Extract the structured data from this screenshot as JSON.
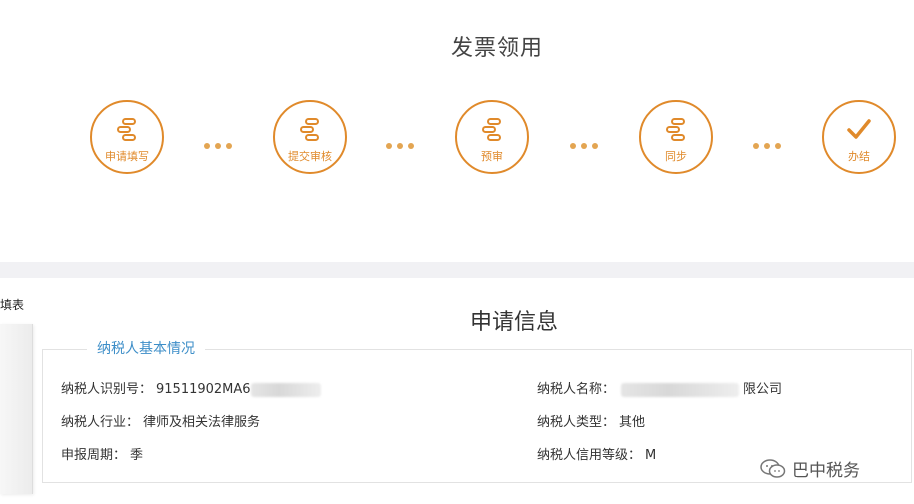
{
  "header": {
    "title": "发票领用"
  },
  "steps": [
    {
      "label": "申请填写",
      "icon": "flow-icon"
    },
    {
      "label": "提交审核",
      "icon": "flow-icon"
    },
    {
      "label": "预审",
      "icon": "flow-icon"
    },
    {
      "label": "同步",
      "icon": "flow-icon"
    },
    {
      "label": "办结",
      "icon": "check-icon"
    }
  ],
  "side": {
    "tab_label": "填表"
  },
  "section": {
    "title": "申请信息",
    "legend": "纳税人基本情况",
    "fields": {
      "tax_id": {
        "label": "纳税人识别号：",
        "value": "91511902MA6"
      },
      "industry": {
        "label": "纳税人行业：",
        "value": "律师及相关法律服务"
      },
      "period": {
        "label": "申报周期：",
        "value": "季"
      },
      "name": {
        "label": "纳税人名称：",
        "value": "限公司"
      },
      "type": {
        "label": "纳税人类型：",
        "value": "其他"
      },
      "credit": {
        "label": "纳税人信用等级：",
        "value": "M"
      }
    }
  },
  "watermark": {
    "text": "巴中税务"
  },
  "colors": {
    "accent": "#e08a2b",
    "legend": "#3d8ec8",
    "separator": "#f1f1f4"
  }
}
